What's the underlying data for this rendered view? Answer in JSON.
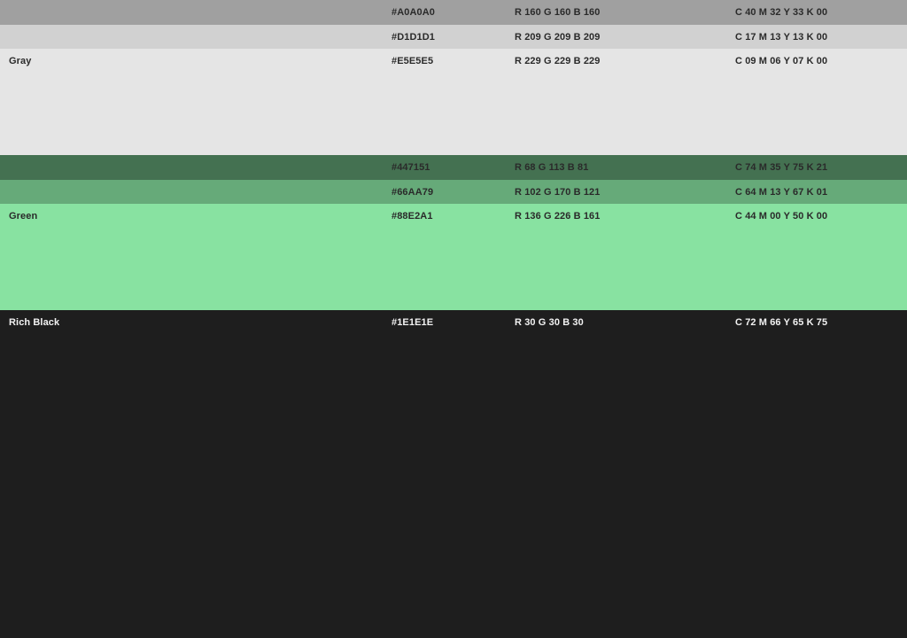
{
  "swatches": [
    {
      "name": "",
      "hex": "#A0A0A0",
      "rgb": "R 160  G 160  B 160",
      "cmyk": "C 40  M 32  Y 33  K 00",
      "color": "#A0A0A0",
      "text_tone": "dark"
    },
    {
      "name": "",
      "hex": "#D1D1D1",
      "rgb": "R 209  G 209  B 209",
      "cmyk": "C 17  M 13  Y 13  K 00",
      "color": "#D1D1D1",
      "text_tone": "dark"
    },
    {
      "name": "Gray",
      "hex": "#E5E5E5",
      "rgb": "R 229  G 229  B 229",
      "cmyk": "C 09  M 06  Y 07  K 00",
      "color": "#E5E5E5",
      "text_tone": "dark"
    },
    {
      "name": "",
      "hex": "#447151",
      "rgb": "R 68  G 113  B 81",
      "cmyk": "C 74  M 35  Y 75  K 21",
      "color": "#447151",
      "text_tone": "dark"
    },
    {
      "name": "",
      "hex": "#66AA79",
      "rgb": "R 102  G 170  B 121",
      "cmyk": "C 64  M 13  Y 67  K 01",
      "color": "#66AA79",
      "text_tone": "dark"
    },
    {
      "name": "Green",
      "hex": "#88E2A1",
      "rgb": "R 136  G 226  B 161",
      "cmyk": "C 44  M 00  Y 50  K 00",
      "color": "#88E2A1",
      "text_tone": "dark"
    },
    {
      "name": "Rich Black",
      "hex": "#1E1E1E",
      "rgb": "R 30  G 30  B 30",
      "cmyk": "C 72  M 66  Y 65  K 75",
      "color": "#1E1E1E",
      "text_tone": "light"
    }
  ]
}
